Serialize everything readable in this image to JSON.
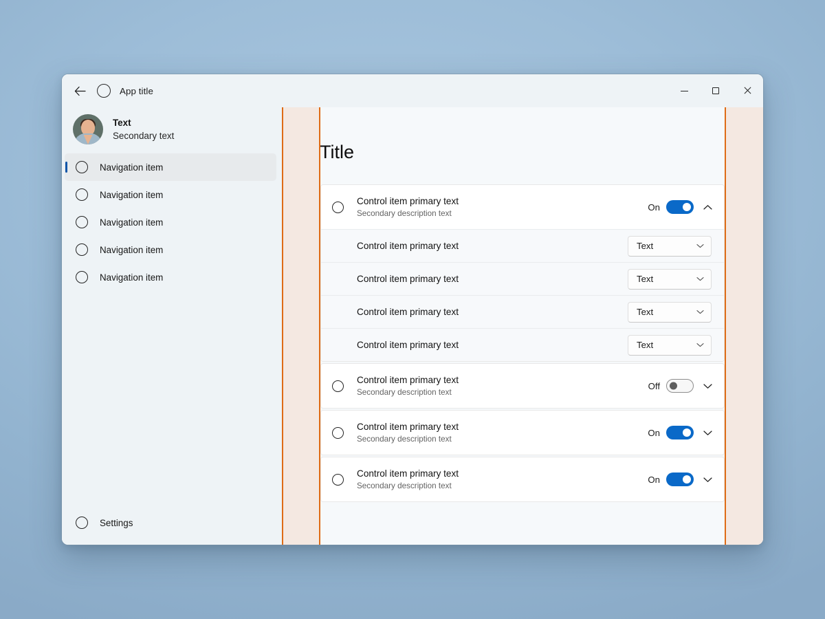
{
  "titlebar": {
    "back_label": "back-arrow",
    "app_icon": "circle-icon",
    "title": "App title",
    "minimize_label": "Minimize",
    "maximize_label": "Maximize",
    "close_label": "Close"
  },
  "sidebar": {
    "account": {
      "avatar": "user-photo-avatar",
      "primary": "Text",
      "secondary": "Secondary text"
    },
    "items": [
      {
        "label": "Navigation item",
        "selected": true
      },
      {
        "label": "Navigation item",
        "selected": false
      },
      {
        "label": "Navigation item",
        "selected": false
      },
      {
        "label": "Navigation item",
        "selected": false
      },
      {
        "label": "Navigation item",
        "selected": false
      }
    ],
    "settings": {
      "label": "Settings",
      "icon": "circle-icon"
    }
  },
  "content": {
    "title": "Title",
    "expanders": [
      {
        "primary": "Control item primary text",
        "secondary": "Secondary description text",
        "toggle_label": "On",
        "toggle_state": "on",
        "chevron": "chevron-up-icon",
        "expanded": true,
        "sub_rows": [
          {
            "label": "Control item primary text",
            "value": "Text"
          },
          {
            "label": "Control item primary text",
            "value": "Text"
          },
          {
            "label": "Control item primary text",
            "value": "Text"
          },
          {
            "label": "Control item primary text",
            "value": "Text"
          }
        ]
      },
      {
        "primary": "Control item primary text",
        "secondary": "Secondary description text",
        "toggle_label": "Off",
        "toggle_state": "off",
        "chevron": "chevron-down-icon",
        "expanded": false,
        "sub_rows": []
      },
      {
        "primary": "Control item primary text",
        "secondary": "Secondary description text",
        "toggle_label": "On",
        "toggle_state": "on",
        "chevron": "chevron-down-icon",
        "expanded": false,
        "sub_rows": []
      },
      {
        "primary": "Control item primary text",
        "secondary": "Secondary description text",
        "toggle_label": "On",
        "toggle_state": "on",
        "chevron": "chevron-down-icon",
        "expanded": false,
        "sub_rows": []
      }
    ]
  },
  "colors": {
    "accent_blue": "#0a69c8",
    "selection_bar": "#0f55a8",
    "gutter_fill": "#f4e8e1",
    "gutter_line": "#de6b15",
    "window_chrome": "#eef3f6",
    "content_bg": "#f6f9fb",
    "card_bg": "#ffffff",
    "desktop_bg": "#9dbdd8"
  }
}
